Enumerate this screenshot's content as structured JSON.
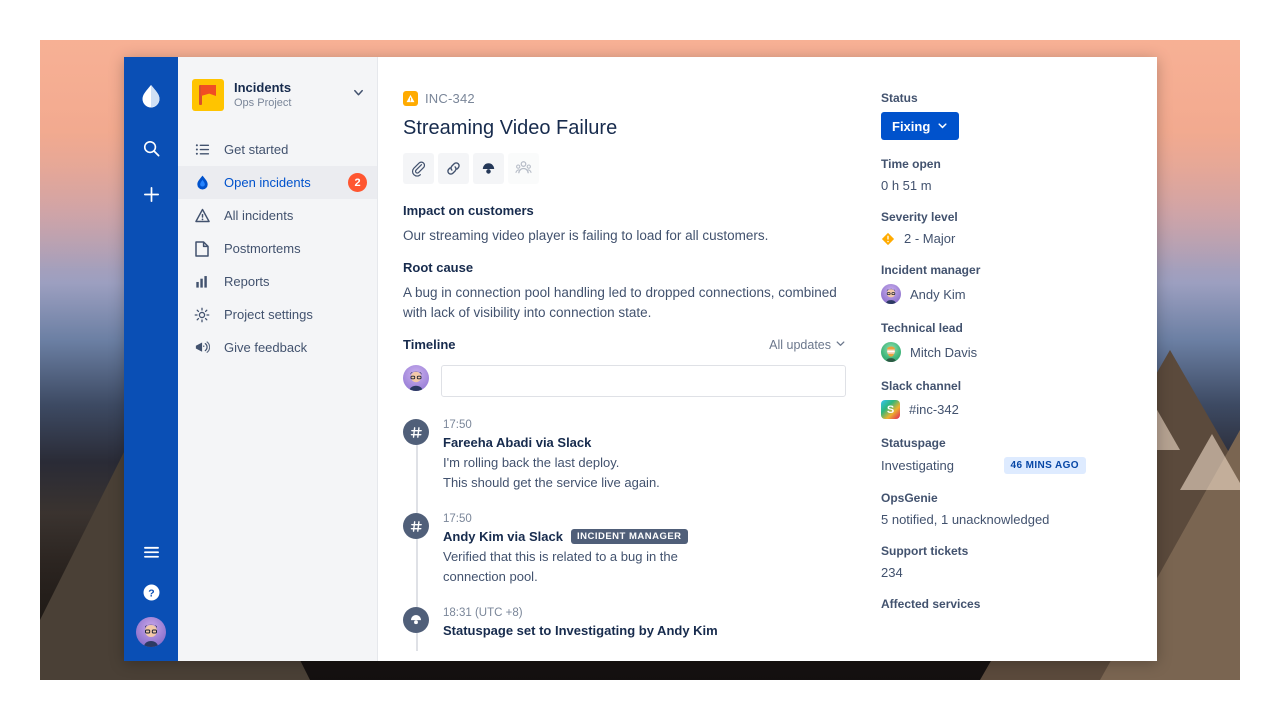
{
  "rail": {
    "logo_icon": "jira-ops-flame-logo-icon",
    "items": [
      {
        "name": "search",
        "icon": "search-icon"
      },
      {
        "name": "create",
        "icon": "plus-icon"
      }
    ],
    "bottom_items": [
      {
        "name": "menu",
        "icon": "hamburger-menu-icon"
      },
      {
        "name": "help",
        "icon": "help-question-icon"
      },
      {
        "name": "profile",
        "icon": "user-avatar-icon"
      }
    ]
  },
  "sidebar": {
    "project": {
      "name": "Incidents",
      "subtitle": "Ops Project",
      "avatar_icon": "project-flag-icon",
      "chevron_icon": "chevron-down-icon",
      "avatar_bg": "#ffc400"
    },
    "items": [
      {
        "label": "Get started",
        "icon": "list-checklist-icon",
        "active": false,
        "badge": ""
      },
      {
        "label": "Open incidents",
        "icon": "flame-icon",
        "active": true,
        "badge": "2"
      },
      {
        "label": "All incidents",
        "icon": "warning-triangle-icon",
        "active": false,
        "badge": ""
      },
      {
        "label": "Postmortems",
        "icon": "document-page-icon",
        "active": false,
        "badge": ""
      },
      {
        "label": "Reports",
        "icon": "bar-chart-icon",
        "active": false,
        "badge": ""
      },
      {
        "label": "Project settings",
        "icon": "gear-icon",
        "active": false,
        "badge": ""
      },
      {
        "label": "Give feedback",
        "icon": "megaphone-icon",
        "active": false,
        "badge": ""
      }
    ],
    "badge_color": "#ff5630",
    "active_color": "#0052cc"
  },
  "incident": {
    "key": "INC-342",
    "key_icon": "incident-severity-icon",
    "title": "Streaming Video Failure",
    "actions": [
      {
        "name": "attach",
        "icon": "paperclip-icon",
        "dim": false
      },
      {
        "name": "link",
        "icon": "link-chain-icon",
        "dim": false
      },
      {
        "name": "statuspage",
        "icon": "megaphone-broadcast-icon",
        "dim": false
      },
      {
        "name": "responders",
        "icon": "people-group-icon",
        "dim": true
      }
    ],
    "sections": [
      {
        "heading": "Impact on customers",
        "body": "Our streaming video player is failing to load for all customers."
      },
      {
        "heading": "Root cause",
        "body": "A bug in connection pool handling led to dropped connections, combined with lack of visibility into connection state."
      }
    ]
  },
  "timeline": {
    "title": "Timeline",
    "filter_label": "All updates",
    "filter_icon": "chevron-down-icon",
    "comment_placeholder": "",
    "comment_value": "",
    "comment_avatar_icon": "user-avatar-icon",
    "entries": [
      {
        "time": "17:50",
        "author": "Fareeha Abadi via Slack",
        "tag": "",
        "icon": "slack-hash-icon",
        "lines": [
          "I'm rolling back the last deploy.",
          "This should get the service live again."
        ]
      },
      {
        "time": "17:50",
        "author": "Andy Kim via Slack",
        "tag": "INCIDENT MANAGER",
        "icon": "slack-hash-icon",
        "lines": [
          "Verified that this is related to a bug in the",
          "connection pool."
        ]
      },
      {
        "time": "18:31 (UTC +8)",
        "author": "Statuspage set to Investigating by Andy Kim",
        "tag": "",
        "icon": "megaphone-broadcast-icon",
        "lines": []
      }
    ]
  },
  "details": {
    "status": {
      "label": "Status",
      "value": "Fixing",
      "chevron_icon": "chevron-down-icon",
      "color": "#0052cc"
    },
    "time_open": {
      "label": "Time open",
      "value": "0 h  51 m"
    },
    "severity": {
      "label": "Severity level",
      "value": "2 - Major",
      "icon": "severity-major-diamond-icon",
      "color": "#ffab00"
    },
    "incident_manager": {
      "label": "Incident manager",
      "value": "Andy Kim",
      "avatar_icon": "user-avatar-icon"
    },
    "technical_lead": {
      "label": "Technical lead",
      "value": "Mitch Davis",
      "avatar_icon": "user-avatar-icon"
    },
    "slack_channel": {
      "label": "Slack channel",
      "value": "#inc-342",
      "icon": "slack-icon"
    },
    "statuspage": {
      "label": "Statuspage",
      "value": "Investigating",
      "badge": "46 MINS AGO"
    },
    "opsgenie": {
      "label": "OpsGenie",
      "value": "5 notified, 1 unacknowledged"
    },
    "support_tickets": {
      "label": "Support tickets",
      "value": "234"
    },
    "affected_services": {
      "label": "Affected services"
    }
  }
}
